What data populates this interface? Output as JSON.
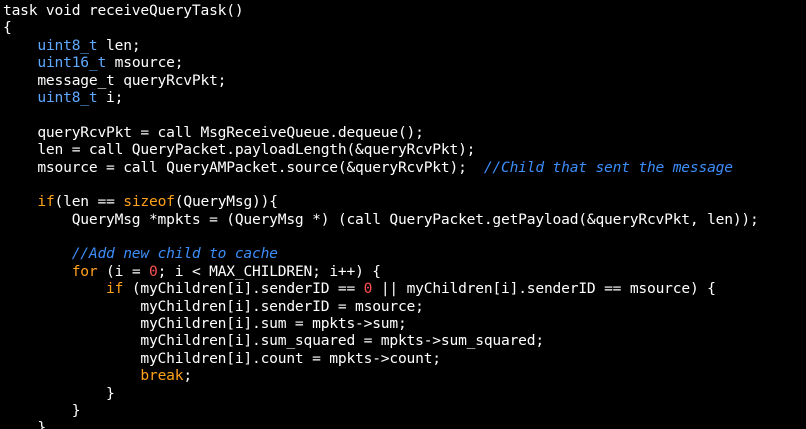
{
  "editor": {
    "colors": {
      "background": "#000000",
      "plain": "#ffffff",
      "type": "#5ea8ff",
      "keyword": "#ffa21a",
      "number": "#ff5151",
      "comment": "#3c8dfa"
    },
    "lines": [
      [
        {
          "t": "task void receiveQueryTask()",
          "c": "plain"
        }
      ],
      [
        {
          "t": "{",
          "c": "plain"
        }
      ],
      [
        {
          "t": "    ",
          "c": "plain"
        },
        {
          "t": "uint8_t",
          "c": "type"
        },
        {
          "t": " len;",
          "c": "plain"
        }
      ],
      [
        {
          "t": "    ",
          "c": "plain"
        },
        {
          "t": "uint16_t",
          "c": "type"
        },
        {
          "t": " msource;",
          "c": "plain"
        }
      ],
      [
        {
          "t": "    message_t queryRcvPkt;",
          "c": "plain"
        }
      ],
      [
        {
          "t": "    ",
          "c": "plain"
        },
        {
          "t": "uint8_t",
          "c": "type"
        },
        {
          "t": " i;",
          "c": "plain"
        }
      ],
      [
        {
          "t": "",
          "c": "plain"
        }
      ],
      [
        {
          "t": "    queryRcvPkt = call MsgReceiveQueue.dequeue();",
          "c": "plain"
        }
      ],
      [
        {
          "t": "    len = call QueryPacket.payloadLength(&queryRcvPkt);",
          "c": "plain"
        }
      ],
      [
        {
          "t": "    msource = call QueryAMPacket.source(&queryRcvPkt);  ",
          "c": "plain"
        },
        {
          "t": "//Child that sent the message",
          "c": "comment"
        }
      ],
      [
        {
          "t": "",
          "c": "plain"
        }
      ],
      [
        {
          "t": "    ",
          "c": "plain"
        },
        {
          "t": "if",
          "c": "keyword"
        },
        {
          "t": "(len == ",
          "c": "plain"
        },
        {
          "t": "sizeof",
          "c": "keyword"
        },
        {
          "t": "(QueryMsg)){",
          "c": "plain"
        }
      ],
      [
        {
          "t": "        QueryMsg *mpkts = (QueryMsg *) (call QueryPacket.getPayload(&queryRcvPkt, len));",
          "c": "plain"
        }
      ],
      [
        {
          "t": "",
          "c": "plain"
        }
      ],
      [
        {
          "t": "        ",
          "c": "plain"
        },
        {
          "t": "//Add new child to cache",
          "c": "comment"
        }
      ],
      [
        {
          "t": "        ",
          "c": "plain"
        },
        {
          "t": "for",
          "c": "keyword"
        },
        {
          "t": " (i = ",
          "c": "plain"
        },
        {
          "t": "0",
          "c": "number"
        },
        {
          "t": "; i < MAX_CHILDREN; i++) {",
          "c": "plain"
        }
      ],
      [
        {
          "t": "            ",
          "c": "plain"
        },
        {
          "t": "if",
          "c": "keyword"
        },
        {
          "t": " (myChildren[i].senderID == ",
          "c": "plain"
        },
        {
          "t": "0",
          "c": "number"
        },
        {
          "t": " || myChildren[i].senderID == msource) {",
          "c": "plain"
        }
      ],
      [
        {
          "t": "                myChildren[i].senderID = msource;",
          "c": "plain"
        }
      ],
      [
        {
          "t": "                myChildren[i].sum = mpkts->sum;",
          "c": "plain"
        }
      ],
      [
        {
          "t": "                myChildren[i].sum_squared = mpkts->sum_squared;",
          "c": "plain"
        }
      ],
      [
        {
          "t": "                myChildren[i].count = mpkts->count;",
          "c": "plain"
        }
      ],
      [
        {
          "t": "                ",
          "c": "plain"
        },
        {
          "t": "break",
          "c": "keyword"
        },
        {
          "t": ";",
          "c": "plain"
        }
      ],
      [
        {
          "t": "            }",
          "c": "plain"
        }
      ],
      [
        {
          "t": "        }",
          "c": "plain"
        }
      ],
      [
        {
          "t": "    }",
          "c": "plain"
        }
      ]
    ]
  }
}
